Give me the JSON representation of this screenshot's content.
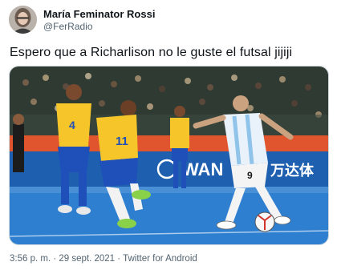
{
  "author": {
    "name": "María Feminator Rossi",
    "handle": "@FerRadio"
  },
  "tweet": {
    "text": "Espero que a Richarlison no le guste el futsal jijiji"
  },
  "photo": {
    "ad_boards": [
      "WAN",
      "万达体"
    ],
    "jersey_numbers": [
      "4",
      "11",
      "9"
    ]
  },
  "meta": {
    "time": "3:56 p. m.",
    "separator": " · ",
    "date": "29 sept. 2021",
    "client": "Twitter for Android"
  },
  "colors": {
    "text": "#0f1419",
    "secondary": "#536471",
    "border": "#cfd9de"
  }
}
